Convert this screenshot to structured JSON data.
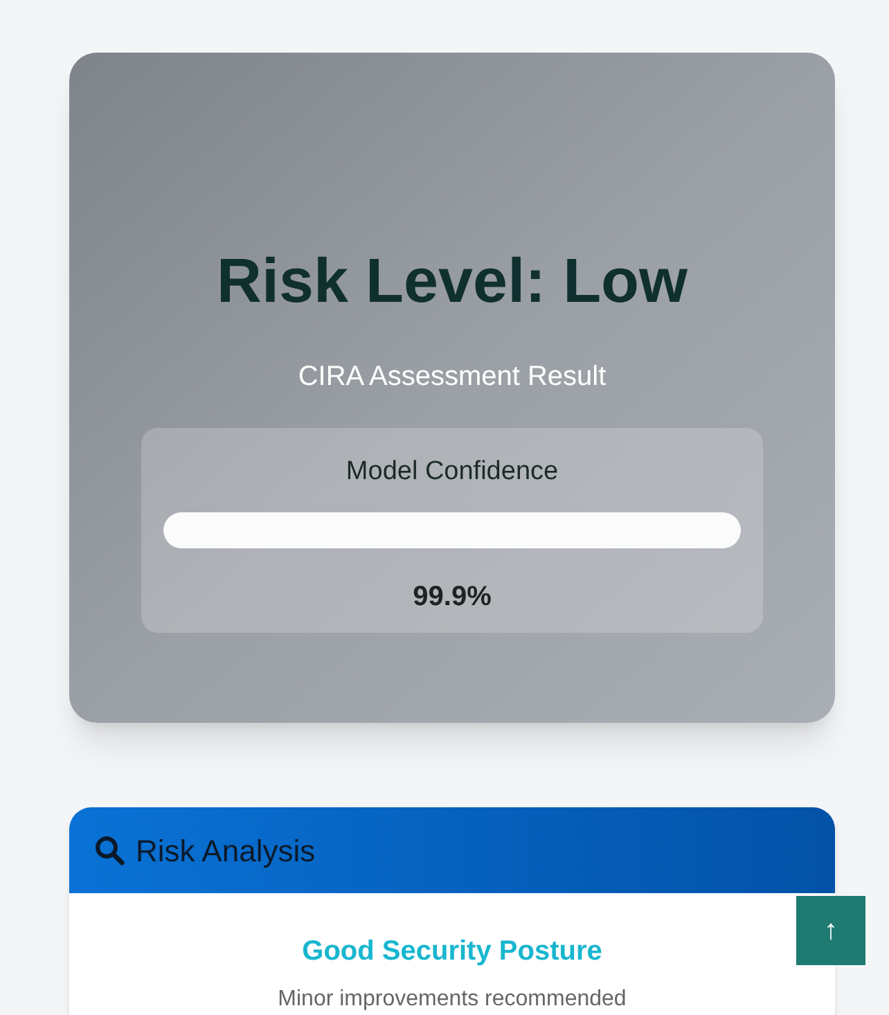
{
  "risk_card": {
    "title": "Risk Level: Low",
    "subtitle": "CIRA Assessment Result",
    "confidence": {
      "label": "Model Confidence",
      "level": 0.999,
      "reading": "99.9%"
    }
  },
  "analysis_card": {
    "title": "Risk Analysis",
    "heading": "Good Security Posture",
    "note": "Minor improvements recommended"
  },
  "scroll_top_button": {
    "label": "↑"
  }
}
